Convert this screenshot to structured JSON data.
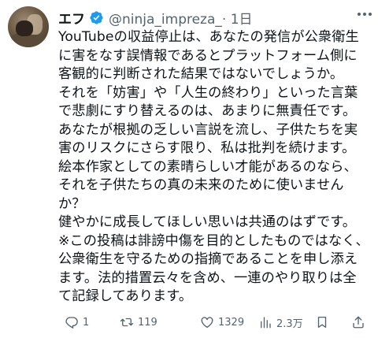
{
  "tweet": {
    "author_name": "エフ",
    "handle_date": "@ninja_impreza_· 1日",
    "lines": [
      "YouTubeの収益停止は、あなたの発信が公衆衛生",
      "に害をなす誤情報であるとプラットフォーム側に",
      "客観的に判断された結果ではないでしょうか。",
      "それを「妨害」や「人生の終わり」といった言葉",
      "で悲劇にすり替えるのは、あまりに無責任です。",
      "あなたが根拠の乏しい言説を流し、子供たちを実",
      "害のリスクにさらす限り、私は批判を続けます。",
      "絵本作家としての素晴らしい才能があるのなら、",
      "それを子供たちの真の未来のために使いません",
      "か？",
      "健やかに成長してほしい思いは共通のはずです。",
      "※この投稿は誹謗中傷を目的としたものではなく、",
      "公衆衛生を守るための指摘であることを申し添え",
      "ます。法的措置云々を含め、一連のやり取りは全",
      "て記録してあります。"
    ]
  },
  "actions": {
    "replies": "1",
    "retweets": "119",
    "likes": "1329",
    "views": "2.3万"
  },
  "colors": {
    "text": "#0f1419",
    "secondary": "#536471",
    "verified": "#1d9bf0"
  },
  "icons": [
    "avatar",
    "verified-badge-icon",
    "more-icon",
    "reply-icon",
    "retweet-icon",
    "like-icon",
    "views-icon",
    "bookmark-icon",
    "share-icon"
  ]
}
